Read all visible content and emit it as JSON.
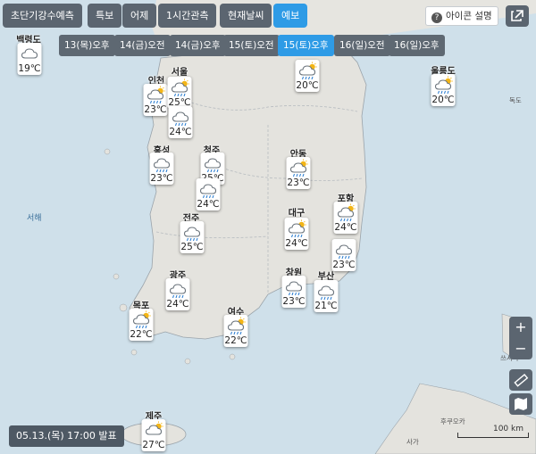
{
  "top_tabs": [
    {
      "label": "초단기강수예측",
      "active": false
    },
    {
      "label": "특보",
      "active": false
    },
    {
      "label": "어제",
      "active": false
    },
    {
      "label": "1시간관측",
      "active": false
    },
    {
      "label": "현재날씨",
      "active": false
    },
    {
      "label": "예보",
      "active": true
    }
  ],
  "legend_button": {
    "label": "아이콘 설명"
  },
  "time_tabs": [
    {
      "label": "13(목)오후",
      "active": false
    },
    {
      "label": "14(금)오전",
      "active": false
    },
    {
      "label": "14(금)오후",
      "active": false
    },
    {
      "label": "15(토)오전",
      "active": false
    },
    {
      "label": "15(토)오후",
      "active": true
    },
    {
      "label": "16(일)오전",
      "active": false
    },
    {
      "label": "16(일)오후",
      "active": false
    }
  ],
  "stations": [
    {
      "name": "백령도",
      "temp": "19℃",
      "icon": "cloudy-icon"
    },
    {
      "name": "인천",
      "temp": "23℃",
      "icon": "partly-cloudy-rain-icon"
    },
    {
      "name": "서울",
      "temp": "25℃",
      "icon": "partly-cloudy-rain-icon"
    },
    {
      "name": "",
      "temp": "24℃",
      "icon": "cloudy-rain-icon"
    },
    {
      "name": "",
      "temp": "20℃",
      "icon": "partly-cloudy-rain-icon"
    },
    {
      "name": "울릉도",
      "temp": "20℃",
      "icon": "partly-cloudy-rain-icon"
    },
    {
      "name": "홍성",
      "temp": "23℃",
      "icon": "cloudy-rain-icon"
    },
    {
      "name": "청주",
      "temp": "25℃",
      "icon": "cloudy-rain-icon"
    },
    {
      "name": "",
      "temp": "24℃",
      "icon": "cloudy-rain-icon"
    },
    {
      "name": "안동",
      "temp": "23℃",
      "icon": "partly-cloudy-rain-icon"
    },
    {
      "name": "포항",
      "temp": "24℃",
      "icon": "partly-cloudy-rain-icon"
    },
    {
      "name": "대구",
      "temp": "24℃",
      "icon": "partly-cloudy-rain-icon"
    },
    {
      "name": "전주",
      "temp": "25℃",
      "icon": "cloudy-rain-icon"
    },
    {
      "name": "",
      "temp": "23℃",
      "icon": "cloudy-rain-icon"
    },
    {
      "name": "광주",
      "temp": "24℃",
      "icon": "cloudy-rain-icon"
    },
    {
      "name": "창원",
      "temp": "23℃",
      "icon": "cloudy-rain-icon"
    },
    {
      "name": "부산",
      "temp": "21℃",
      "icon": "cloudy-rain-icon"
    },
    {
      "name": "목포",
      "temp": "22℃",
      "icon": "partly-cloudy-rain-icon"
    },
    {
      "name": "여수",
      "temp": "22℃",
      "icon": "partly-cloudy-rain-icon"
    },
    {
      "name": "제주",
      "temp": "27℃",
      "icon": "partly-cloudy-icon"
    }
  ],
  "map_labels": {
    "west_sea": "서해",
    "dokdo": "독도",
    "tsushima": "쓰시마",
    "fukuoka": "후쿠오카",
    "saga": "사가"
  },
  "zoom": {
    "in": "+",
    "out": "−"
  },
  "issued": "05.13.(목) 17:00 발표",
  "scale": "100 km",
  "colors": {
    "tab": "#5b6570",
    "active": "#2e9be6",
    "sea": "#cfe0ea",
    "land": "#e4e3de"
  }
}
